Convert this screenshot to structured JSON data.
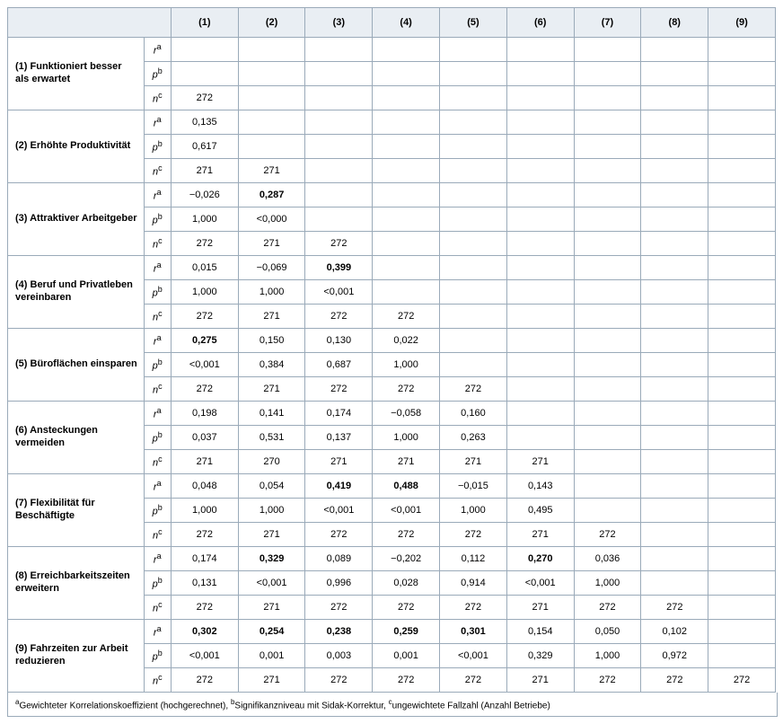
{
  "headers": [
    "(1)",
    "(2)",
    "(3)",
    "(4)",
    "(5)",
    "(6)",
    "(7)",
    "(8)",
    "(9)"
  ],
  "stat_labels": {
    "r": "r",
    "p": "p",
    "n": "n"
  },
  "stat_sup": {
    "r": "a",
    "p": "b",
    "n": "c"
  },
  "rows": [
    {
      "label": "(1) Funktioniert besser als erwartet",
      "r": [
        "",
        "",
        "",
        "",
        "",
        "",
        "",
        "",
        ""
      ],
      "p": [
        "",
        "",
        "",
        "",
        "",
        "",
        "",
        "",
        ""
      ],
      "n": [
        "272",
        "",
        "",
        "",
        "",
        "",
        "",
        "",
        ""
      ]
    },
    {
      "label": "(2) Erhöhte Produktivität",
      "r": [
        "0,135",
        "",
        "",
        "",
        "",
        "",
        "",
        "",
        ""
      ],
      "p": [
        "0,617",
        "",
        "",
        "",
        "",
        "",
        "",
        "",
        ""
      ],
      "n": [
        "271",
        "271",
        "",
        "",
        "",
        "",
        "",
        "",
        ""
      ]
    },
    {
      "label": "(3) Attraktiver Arbeitgeber",
      "r": [
        "−0,026",
        "0,287",
        "",
        "",
        "",
        "",
        "",
        "",
        ""
      ],
      "r_bold": [
        false,
        true,
        false,
        false,
        false,
        false,
        false,
        false,
        false
      ],
      "p": [
        "1,000",
        "<0,000",
        "",
        "",
        "",
        "",
        "",
        "",
        ""
      ],
      "n": [
        "272",
        "271",
        "272",
        "",
        "",
        "",
        "",
        "",
        ""
      ]
    },
    {
      "label": "(4) Beruf und Privatleben vereinbaren",
      "r": [
        "0,015",
        "−0,069",
        "0,399",
        "",
        "",
        "",
        "",
        "",
        ""
      ],
      "r_bold": [
        false,
        false,
        true,
        false,
        false,
        false,
        false,
        false,
        false
      ],
      "p": [
        "1,000",
        "1,000",
        "<0,001",
        "",
        "",
        "",
        "",
        "",
        ""
      ],
      "n": [
        "272",
        "271",
        "272",
        "272",
        "",
        "",
        "",
        "",
        ""
      ]
    },
    {
      "label": "(5) Büroflächen einsparen",
      "r": [
        "0,275",
        "0,150",
        "0,130",
        "0,022",
        "",
        "",
        "",
        "",
        ""
      ],
      "r_bold": [
        true,
        false,
        false,
        false,
        false,
        false,
        false,
        false,
        false
      ],
      "p": [
        "<0,001",
        "0,384",
        "0,687",
        "1,000",
        "",
        "",
        "",
        "",
        ""
      ],
      "n": [
        "272",
        "271",
        "272",
        "272",
        "272",
        "",
        "",
        "",
        ""
      ]
    },
    {
      "label": "(6) Ansteckungen vermeiden",
      "r": [
        "0,198",
        "0,141",
        "0,174",
        "−0,058",
        "0,160",
        "",
        "",
        "",
        ""
      ],
      "p": [
        "0,037",
        "0,531",
        "0,137",
        "1,000",
        "0,263",
        "",
        "",
        "",
        ""
      ],
      "n": [
        "271",
        "270",
        "271",
        "271",
        "271",
        "271",
        "",
        "",
        ""
      ]
    },
    {
      "label": "(7) Flexibilität für Beschäftigte",
      "r": [
        "0,048",
        "0,054",
        "0,419",
        "0,488",
        "−0,015",
        "0,143",
        "",
        "",
        ""
      ],
      "r_bold": [
        false,
        false,
        true,
        true,
        false,
        false,
        false,
        false,
        false
      ],
      "p": [
        "1,000",
        "1,000",
        "<0,001",
        "<0,001",
        "1,000",
        "0,495",
        "",
        "",
        ""
      ],
      "n": [
        "272",
        "271",
        "272",
        "272",
        "272",
        "271",
        "272",
        "",
        ""
      ]
    },
    {
      "label": "(8) Erreichbarkeitszeiten erweitern",
      "r": [
        "0,174",
        "0,329",
        "0,089",
        "−0,202",
        "0,112",
        "0,270",
        "0,036",
        "",
        ""
      ],
      "r_bold": [
        false,
        true,
        false,
        false,
        false,
        true,
        false,
        false,
        false
      ],
      "p": [
        "0,131",
        "<0,001",
        "0,996",
        "0,028",
        "0,914",
        "<0,001",
        "1,000",
        "",
        ""
      ],
      "n": [
        "272",
        "271",
        "272",
        "272",
        "272",
        "271",
        "272",
        "272",
        ""
      ]
    },
    {
      "label": "(9) Fahrzeiten zur Arbeit reduzieren",
      "r": [
        "0,302",
        "0,254",
        "0,238",
        "0,259",
        "0,301",
        "0,154",
        "0,050",
        "0,102",
        ""
      ],
      "r_bold": [
        true,
        true,
        true,
        true,
        true,
        false,
        false,
        false,
        false
      ],
      "p": [
        "<0,001",
        "0,001",
        "0,003",
        "0,001",
        "<0,001",
        "0,329",
        "1,000",
        "0,972",
        ""
      ],
      "n": [
        "272",
        "271",
        "272",
        "272",
        "272",
        "271",
        "272",
        "272",
        "272"
      ]
    }
  ],
  "footnote_parts": {
    "a_sup": "a",
    "a_text": "Gewichteter Korrelationskoeffizient (hochgerechnet), ",
    "b_sup": "b",
    "b_text": "Signifikanzniveau mit Sidak-Korrektur, ",
    "c_sup": "c",
    "c_text": "ungewichtete Fallzahl (Anzahl Betriebe)"
  },
  "chart_data": {
    "type": "table",
    "description": "Correlation matrix (lower triangle) of 9 variables; each pair reports weighted correlation r, Sidak-corrected p, and unweighted n.",
    "variables": [
      "Funktioniert besser als erwartet",
      "Erhöhte Produktivität",
      "Attraktiver Arbeitgeber",
      "Beruf und Privatleben vereinbaren",
      "Büroflächen einsparen",
      "Ansteckungen vermeiden",
      "Flexibilität für Beschäftigte",
      "Erreichbarkeitszeiten erweitern",
      "Fahrzeiten zur Arbeit reduzieren"
    ]
  }
}
